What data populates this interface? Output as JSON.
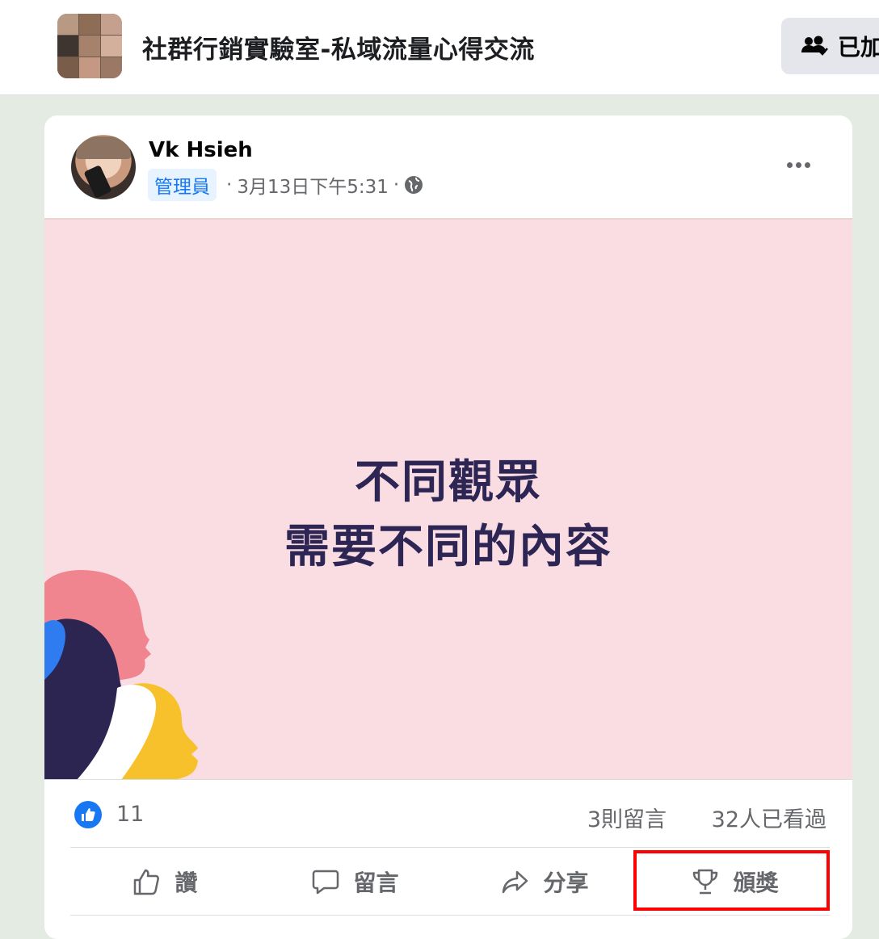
{
  "group": {
    "title": "社群行銷實驗室-私域流量心得交流",
    "joined_label": "已加"
  },
  "post": {
    "author": "Vk Hsieh",
    "role_badge": "管理員",
    "timestamp": "3月13日下午5:31",
    "privacy_icon": "globe-icon",
    "image_text_line1": "不同觀眾",
    "image_text_line2": "需要不同的內容",
    "like_count": "11",
    "comments_count": "3則留言",
    "views_count": "32人已看過"
  },
  "actions": {
    "like": "讚",
    "comment": "留言",
    "share": "分享",
    "award": "頒獎"
  },
  "colors": {
    "accent": "#1877f2",
    "poster_bg": "#fadde3",
    "poster_text": "#2d2654",
    "highlight": "#ff0000"
  }
}
